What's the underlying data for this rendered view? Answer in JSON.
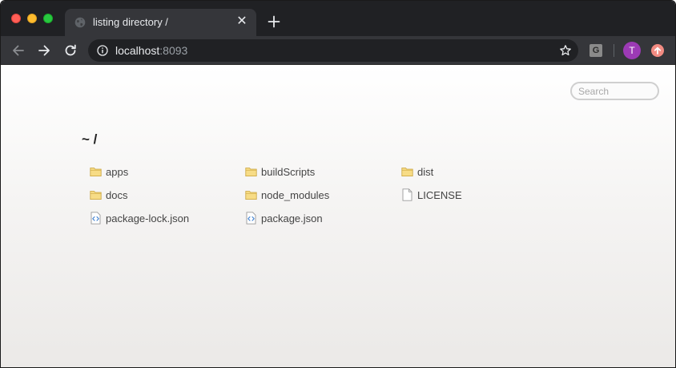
{
  "browser": {
    "tab": {
      "title": "listing directory /"
    },
    "omnibox": {
      "host": "localhost",
      "port": ":8093"
    },
    "extension_label": "G",
    "profile_initial": "T"
  },
  "page": {
    "search_placeholder": "Search",
    "breadcrumb": "~ /",
    "files": [
      {
        "name": "apps",
        "icon": "folder-icon"
      },
      {
        "name": "buildScripts",
        "icon": "folder-icon"
      },
      {
        "name": "dist",
        "icon": "folder-icon"
      },
      {
        "name": "docs",
        "icon": "folder-icon"
      },
      {
        "name": "node_modules",
        "icon": "folder-icon"
      },
      {
        "name": "LICENSE",
        "icon": "file-icon"
      },
      {
        "name": "package-lock.json",
        "icon": "code-file-icon"
      },
      {
        "name": "package.json",
        "icon": "code-file-icon"
      }
    ]
  },
  "colors": {
    "chrome_dark": "#202124",
    "tab_active": "#35363a",
    "folder": "#f0c74b",
    "avatar": "#9c3ab5"
  }
}
